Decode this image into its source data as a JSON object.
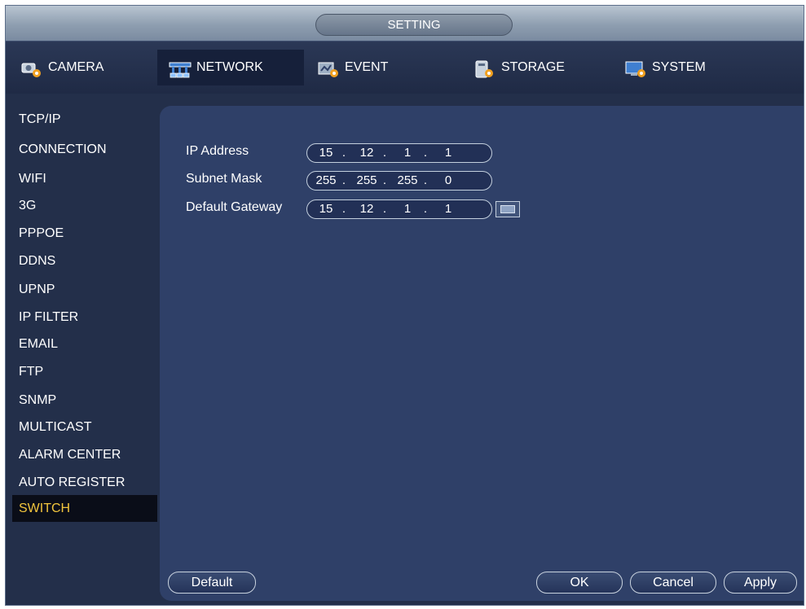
{
  "window": {
    "title": "SETTING"
  },
  "tabs": [
    {
      "label": "CAMERA",
      "icon": "camera-gear-icon"
    },
    {
      "label": "NETWORK",
      "icon": "network-icon",
      "active": true
    },
    {
      "label": "EVENT",
      "icon": "event-icon"
    },
    {
      "label": "STORAGE",
      "icon": "storage-icon"
    },
    {
      "label": "SYSTEM",
      "icon": "system-icon"
    }
  ],
  "sidebar": {
    "items": [
      {
        "label": "TCP/IP"
      },
      {
        "label": "CONNECTION"
      },
      {
        "label": "WIFI"
      },
      {
        "label": "3G"
      },
      {
        "label": "PPPOE"
      },
      {
        "label": "DDNS"
      },
      {
        "label": "UPNP"
      },
      {
        "label": "IP FILTER"
      },
      {
        "label": "EMAIL"
      },
      {
        "label": "FTP"
      },
      {
        "label": "SNMP"
      },
      {
        "label": "MULTICAST"
      },
      {
        "label": "ALARM CENTER"
      },
      {
        "label": "AUTO REGISTER"
      },
      {
        "label": "SWITCH",
        "active": true
      }
    ]
  },
  "form": {
    "ip_address": {
      "label": "IP Address",
      "octets": [
        "15",
        "12",
        "1",
        "1"
      ]
    },
    "subnet_mask": {
      "label": "Subnet Mask",
      "octets": [
        "255",
        "255",
        "255",
        "0"
      ]
    },
    "default_gateway": {
      "label": "Default Gateway",
      "octets": [
        "15",
        "12",
        "1",
        "1"
      ]
    },
    "separator": "."
  },
  "buttons": {
    "default": "Default",
    "ok": "OK",
    "cancel": "Cancel",
    "apply": "Apply"
  },
  "colors": {
    "active_sidebar_text": "#f2c53d",
    "field_label_text": "#ffffff",
    "panel_bg": "#2f4068"
  }
}
